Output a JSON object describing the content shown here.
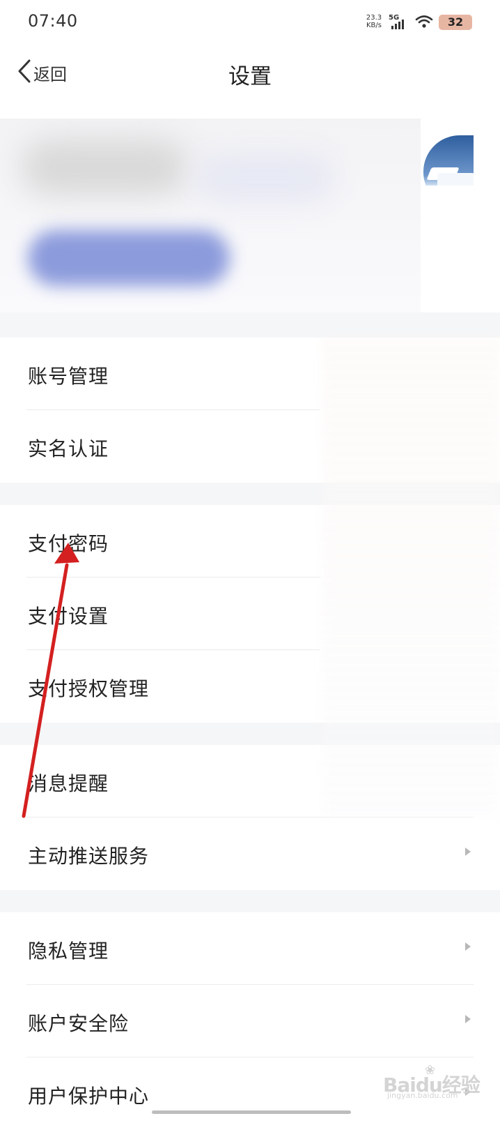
{
  "status_bar": {
    "time": "07:40",
    "net_speed_value": "23.3",
    "net_speed_unit": "KB/s",
    "network_tag": "5G",
    "battery": "32",
    "battery_color": "#e7b6a3",
    "icons": [
      "signal-icon",
      "wifi-icon",
      "battery-icon"
    ]
  },
  "nav": {
    "back_label": "返回",
    "back_icon": "chevron-left-icon",
    "title": "设置"
  },
  "profile": {
    "avatar_icon": "avatar",
    "blur_accent_color": "#8c9bdc"
  },
  "groups": [
    {
      "items": [
        {
          "label": "账号管理"
        },
        {
          "label": "实名认证"
        }
      ]
    },
    {
      "items": [
        {
          "label": "支付密码"
        },
        {
          "label": "支付设置"
        },
        {
          "label": "支付授权管理"
        }
      ]
    },
    {
      "items": [
        {
          "label": "消息提醒"
        },
        {
          "label": "主动推送服务"
        }
      ]
    },
    {
      "items": [
        {
          "label": "隐私管理"
        },
        {
          "label": "账户安全险"
        },
        {
          "label": "用户保护中心"
        }
      ]
    }
  ],
  "annotation": {
    "icon": "red-arrow-icon",
    "color": "#d42020"
  },
  "watermark": {
    "text": "Baidu经验",
    "sub": "jingyan.baidu.com"
  },
  "colors": {
    "gap_background": "#f5f6f8",
    "divider": "#ececec",
    "chevron": "#b8b8b8"
  }
}
